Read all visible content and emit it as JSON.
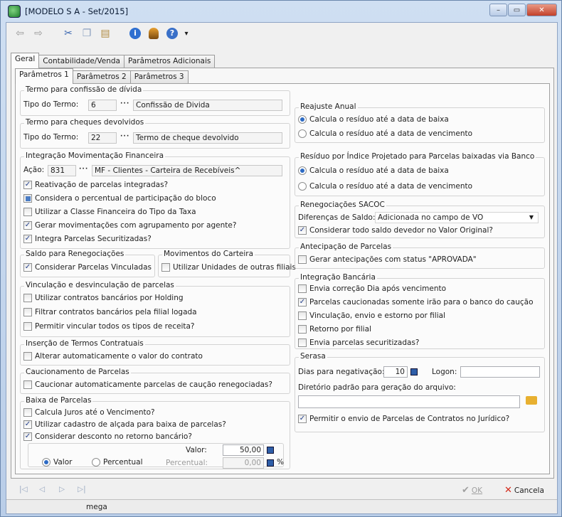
{
  "window": {
    "title": "[MODELO S A - Set/2015]",
    "min": "–",
    "max": "▭",
    "close": "✕"
  },
  "toolbar": {
    "icons": [
      "back-icon",
      "forward-icon",
      "cut-icon",
      "copy-icon",
      "paste-icon",
      "info-icon",
      "users-icon",
      "help-icon"
    ],
    "dropdown": "▾"
  },
  "tabs": {
    "main": [
      "Geral",
      "Contabilidade/Venda",
      "Parâmetros Adicionais"
    ],
    "sub": [
      "Parâmetros 1",
      "Parâmetros 2",
      "Parâmetros 3"
    ]
  },
  "confissao": {
    "title": "Termo para confissão de dívida",
    "label": "Tipo do Termo:",
    "code": "6",
    "dots": "···",
    "desc": "Confissão de Divida"
  },
  "cheques": {
    "title": "Termo para cheques devolvidos",
    "label": "Tipo do Termo:",
    "code": "22",
    "dots": "···",
    "desc": "Termo de cheque devolvido"
  },
  "integracao": {
    "title": "Integração Movimentação Financeira",
    "label": "Ação:",
    "code": "831",
    "dots": "···",
    "desc": "MF - Clientes - Carteira de Recebíveis^",
    "checks": [
      "Reativação de parcelas integradas?",
      "Considera o percentual de participação do bloco",
      "Utilizar a Classe Financeira do Tipo da Taxa",
      "Gerar movimentações com agrupamento por agente?",
      "Integra Parcelas Securitizadas?"
    ]
  },
  "saldo": {
    "title": "Saldo para Renegociações",
    "check": "Considerar Parcelas Vinculadas"
  },
  "movimentos": {
    "title": "Movimentos do Carteira",
    "check": "Utilizar Unidades de outras filiais"
  },
  "vinculacao": {
    "title": "Vinculação e desvinculação de parcelas",
    "checks": [
      "Utilizar contratos bancários por Holding",
      "Filtrar contratos bancários pela filial logada",
      "Permitir vincular todos os tipos de receita?"
    ]
  },
  "insercao": {
    "title": "Inserção de Termos Contratuais",
    "check": "Alterar automaticamente o valor do contrato"
  },
  "caucionamento": {
    "title": "Caucionamento de Parcelas",
    "check": "Caucionar automaticamente parcelas de caução renegociadas?"
  },
  "baixa": {
    "title": "Baixa de Parcelas",
    "checks": [
      "Calcula Juros até o Vencimento?",
      "Utilizar cadastro de alçada para baixa de parcelas?",
      "Considerar desconto no retorno bancário?"
    ],
    "valor_label": "Valor:",
    "valor": "50,00",
    "perc_label": "Percentual:",
    "perc": "0,00",
    "perc_unit": "%",
    "radio_valor": "Valor",
    "radio_perc": "Percentual"
  },
  "reajuste": {
    "title": "Reajuste Anual",
    "options": [
      "Calcula o resíduo até a data de baixa",
      "Calcula o resíduo até a data de vencimento"
    ]
  },
  "residuo": {
    "title": "Resíduo por Índice Projetado para Parcelas baixadas via Banco",
    "options": [
      "Calcula o resíduo até a data de baixa",
      "Calcula o resíduo até a data de vencimento"
    ]
  },
  "sacoc": {
    "title": "Renegociações SACOC",
    "label": "Diferenças de Saldo:",
    "select": "Adicionada no campo de VO",
    "arrow": "▼",
    "check": "Considerar todo saldo devedor no Valor Original?"
  },
  "antecipacao": {
    "title": "Antecipação de Parcelas",
    "check": "Gerar antecipações com status \"APROVADA\""
  },
  "bancaria": {
    "title": "Integração Bancária",
    "checks": [
      "Envia correção Dia após vencimento",
      "Parcelas caucionadas somente irão para o banco do caução",
      "Vinculação, envio e estorno por filial",
      "Retorno por filial",
      "Envia parcelas securitizadas?"
    ]
  },
  "serasa": {
    "title": "Serasa",
    "dias_label": "Dias para negativação:",
    "dias": "10",
    "logon_label": "Logon:",
    "logon": "",
    "dir_label": "Diretório padrão para geração do arquivo:",
    "dir": "",
    "check": "Permitir o envio de Parcelas de Contratos no Jurídico?"
  },
  "nav": [
    "|◁",
    "◁",
    "▷",
    "▷|"
  ],
  "buttons": {
    "ok": "OK",
    "cancel": "Cancela"
  },
  "status": {
    "text": "mega"
  },
  "colors": {
    "accent": "#2d6bc4",
    "close_btn": "#c2402a",
    "cancel_x": "#d42a1a"
  }
}
